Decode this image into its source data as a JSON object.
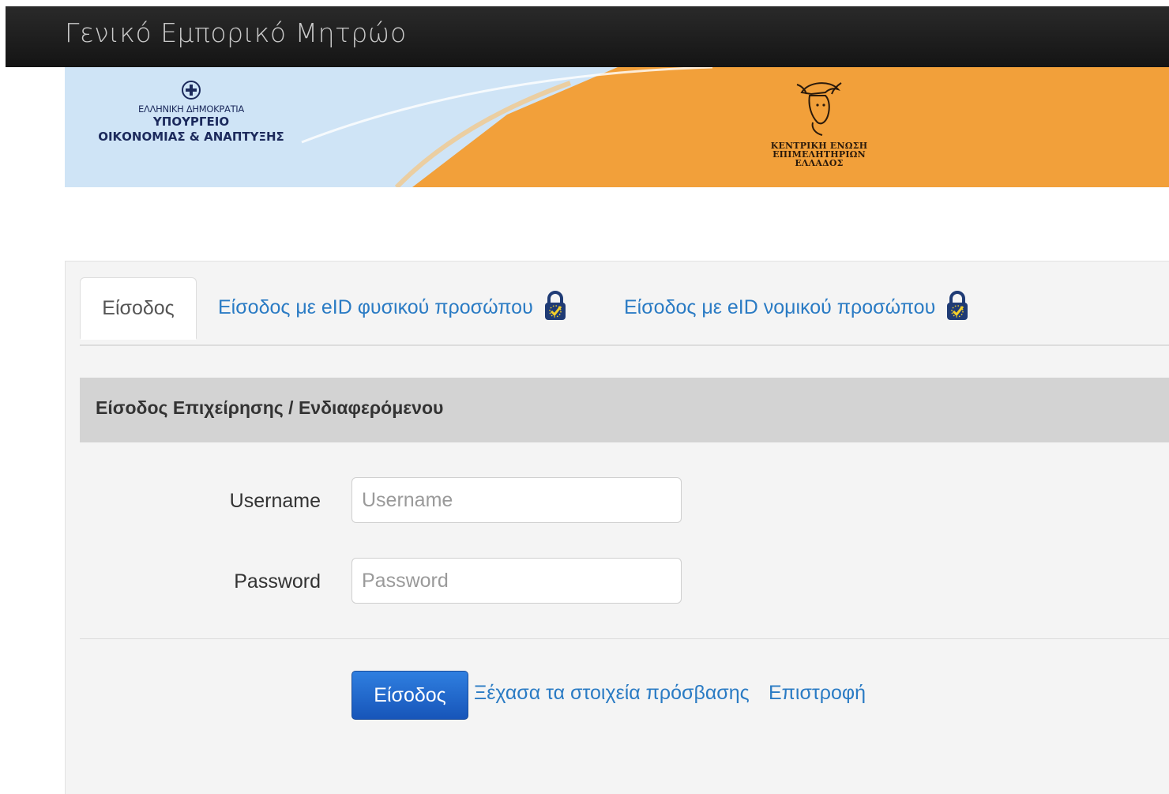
{
  "navbar": {
    "brand": "Γενικό Εμπορικό Μητρώο"
  },
  "banner": {
    "ministry": {
      "line1": "ΕΛΛΗΝΙΚΗ ΔΗΜΟΚΡΑΤΙΑ",
      "line2": "ΥΠΟΥΡΓΕΙΟ",
      "line3": "ΟΙΚΟΝΟΜΙΑΣ & ΑΝΑΠΤΥΞΗΣ"
    },
    "chamber": {
      "line1": "ΚΕΝΤΡΙΚΗ ΕΝΩΣΗ",
      "line2": "ΕΠΙΜΕΛΗΤΗΡΙΩΝ",
      "line3": "ΕΛΛΑΔΟΣ"
    },
    "colors": {
      "left": "#cfe3f5",
      "right": "#f2a03a"
    }
  },
  "tabs": [
    {
      "label": "Είσοδος",
      "active": true
    },
    {
      "label": "Είσοδος με eID φυσικού προσώπου",
      "icon": "eid-lock-icon"
    },
    {
      "label": "Είσοδος με eID νομικού προσώπου",
      "icon": "eid-lock-icon"
    }
  ],
  "section": {
    "title": "Είσοδος Επιχείρησης / Ενδιαφερόμενου"
  },
  "form": {
    "username": {
      "label": "Username",
      "placeholder": "Username",
      "value": ""
    },
    "password": {
      "label": "Password",
      "placeholder": "Password",
      "value": ""
    }
  },
  "actions": {
    "login": "Είσοδος",
    "forgot": "Ξέχασα τα στοιχεία πρόσβασης",
    "back": "Επιστροφή"
  },
  "colors": {
    "link": "#2a7bc4",
    "primary": "#1f66cc",
    "navbar": "#1a1a1a"
  }
}
